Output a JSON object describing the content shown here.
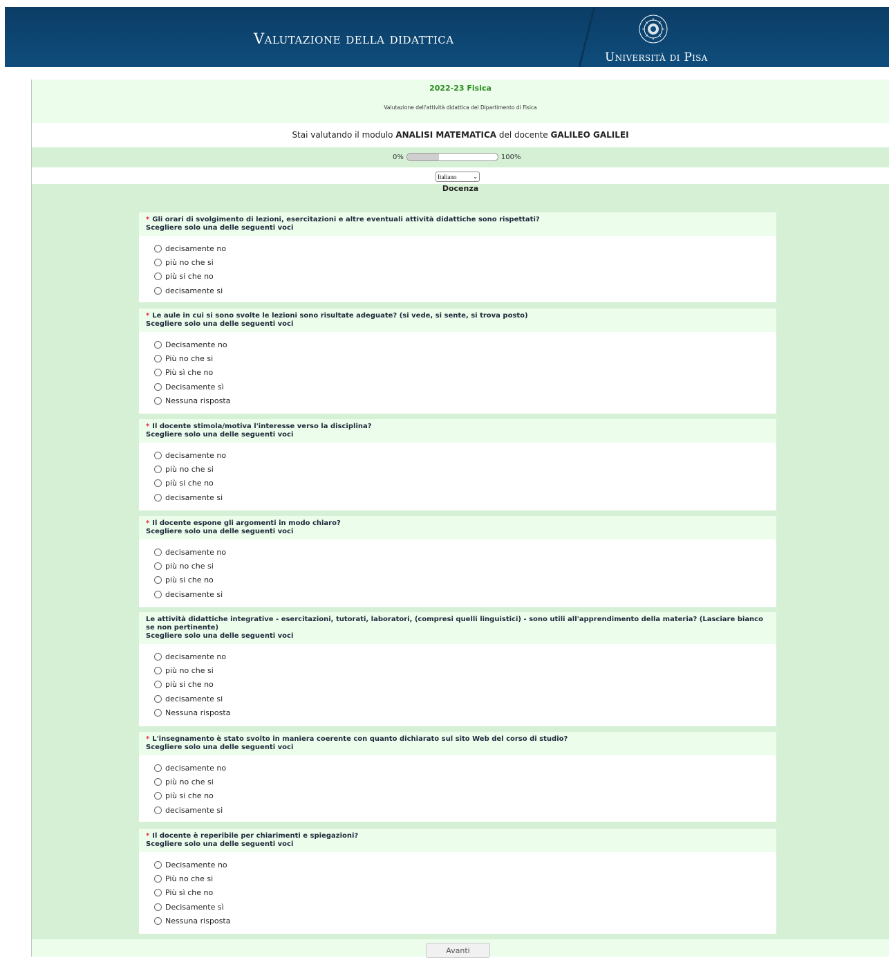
{
  "header": {
    "title": "Valutazione della didattica",
    "university": "Università di Pisa"
  },
  "survey": {
    "title": "2022-23 Fisica",
    "description": "Valutazione dell'attività didattica del Dipartimento di Fisica"
  },
  "module": {
    "prefix": "Stai valutando il modulo",
    "name": "ANALISI MATEMATICA",
    "middle": "del docente",
    "teacher": "GALILEO GALILEI"
  },
  "progress": {
    "min_label": "0%",
    "max_label": "100%",
    "value_percent": 35
  },
  "language": {
    "selected": "Italiano"
  },
  "group_title": "Docenza",
  "questions": [
    {
      "required": "*",
      "text": "Gli orari di svolgimento di lezioni, esercitazioni e altre eventuali attività didattiche sono rispettati?",
      "help": "Scegliere solo una delle seguenti voci",
      "options": [
        "decisamente no",
        "più no che si",
        "più si che no",
        "decisamente si"
      ]
    },
    {
      "required": "*",
      "text": "Le aule in cui si sono svolte le lezioni sono risultate adeguate? (si vede, si sente, si trova posto)",
      "help": "Scegliere solo una delle seguenti voci",
      "options": [
        "Decisamente no",
        "Più no che si",
        "Più sì che no",
        "Decisamente sì",
        "Nessuna risposta"
      ]
    },
    {
      "required": "*",
      "text": "Il docente stimola/motiva l'interesse verso la disciplina?",
      "help": "Scegliere solo una delle seguenti voci",
      "options": [
        "decisamente no",
        "più no che si",
        "più si che no",
        "decisamente si"
      ]
    },
    {
      "required": "*",
      "text": "Il docente espone gli argomenti in modo chiaro?",
      "help": "Scegliere solo una delle seguenti voci",
      "options": [
        "decisamente no",
        "più no che si",
        "più si che no",
        "decisamente si"
      ]
    },
    {
      "required": "",
      "text": "Le attività didattiche integrative - esercitazioni, tutorati, laboratori, (compresi quelli linguistici) - sono utili all'apprendimento della materia? (Lasciare bianco se non pertinente)",
      "help": "Scegliere solo una delle seguenti voci",
      "options": [
        "decisamente no",
        "più no che si",
        "più si che no",
        "decisamente si",
        "Nessuna risposta"
      ]
    },
    {
      "required": "*",
      "text": "L'insegnamento è stato svolto in maniera coerente con quanto dichiarato sul sito Web del corso di studio?",
      "help": "Scegliere solo una delle seguenti voci",
      "options": [
        "decisamente no",
        "più no che si",
        "più si che no",
        "decisamente si"
      ]
    },
    {
      "required": "*",
      "text": "Il docente è reperibile per chiarimenti e spiegazioni?",
      "help": "Scegliere solo una delle seguenti voci",
      "options": [
        "Decisamente no",
        "Più no che si",
        "Più sì che no",
        "Decisamente sì",
        "Nessuna risposta"
      ]
    }
  ],
  "nav": {
    "next_label": "Avanti"
  }
}
